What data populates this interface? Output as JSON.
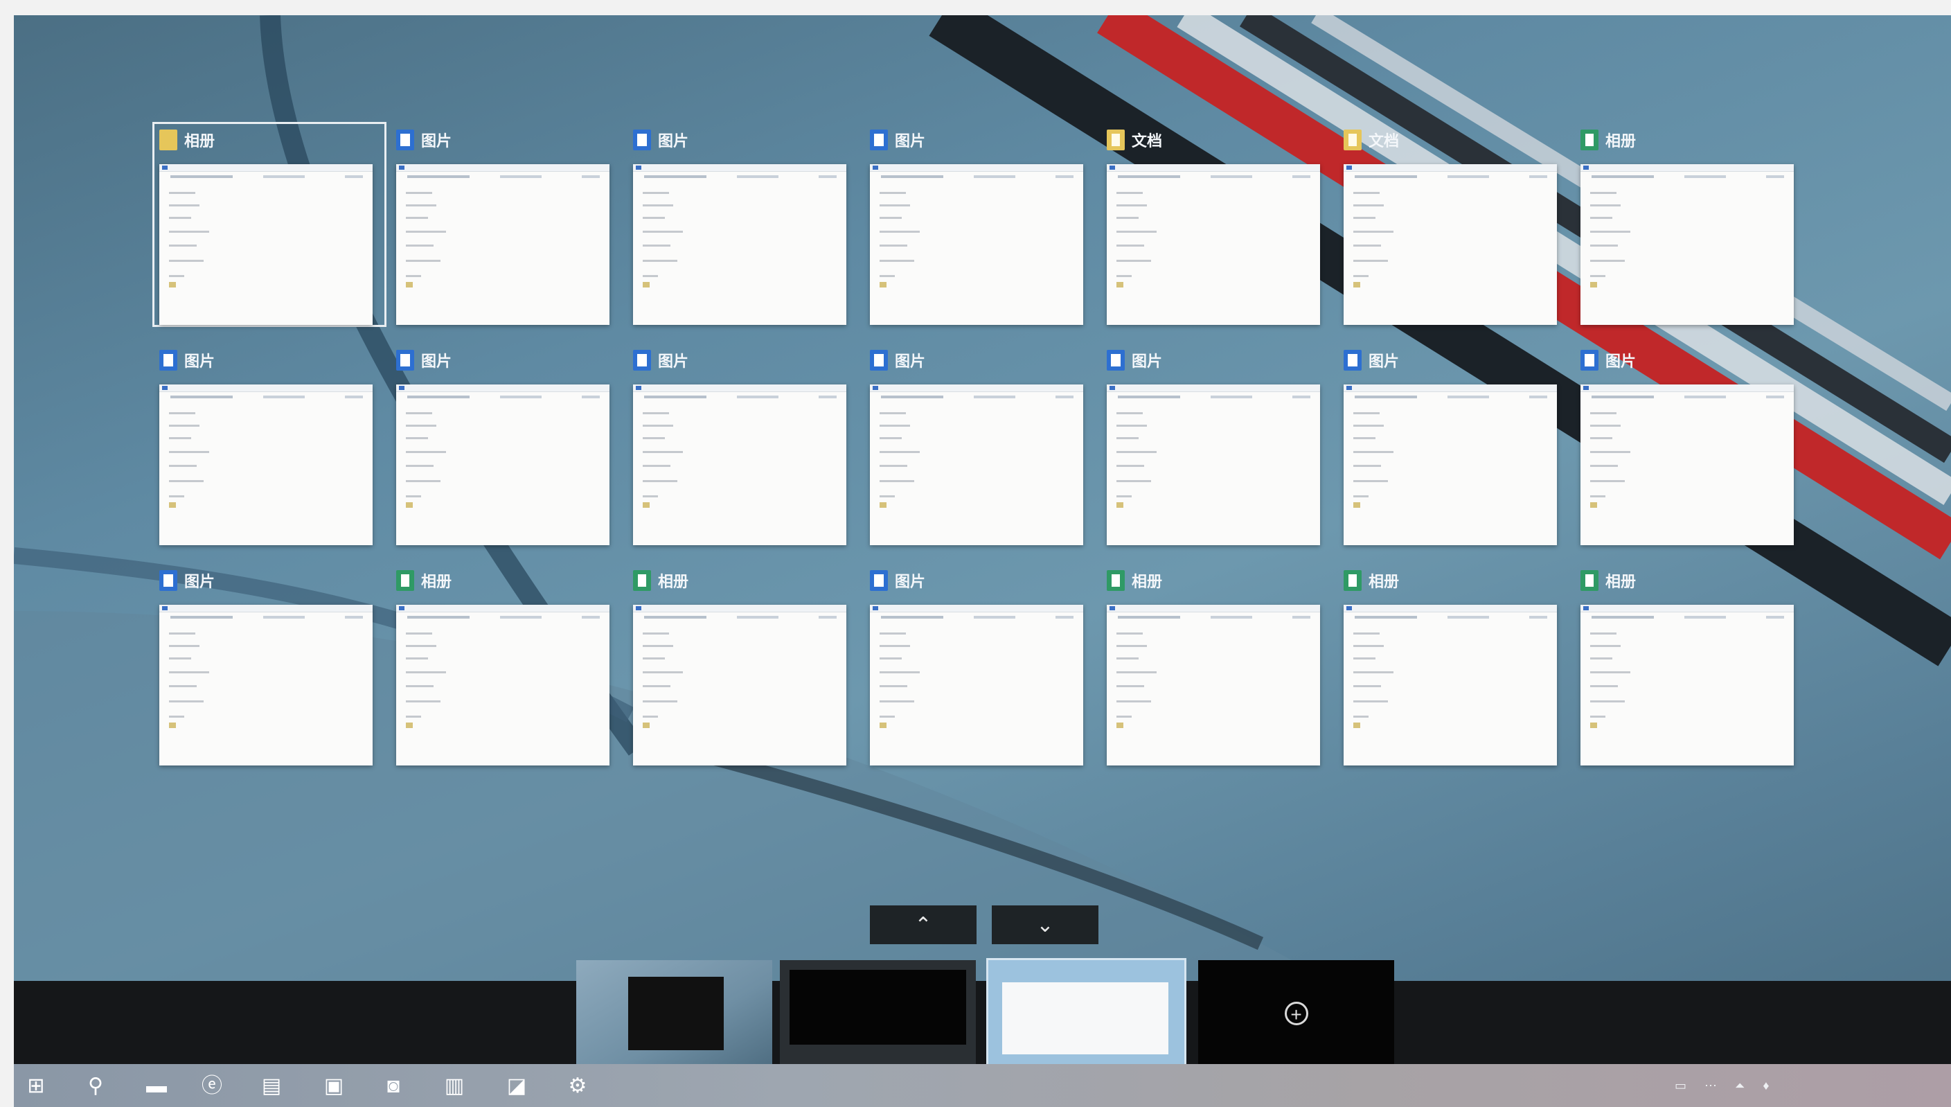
{
  "wallpaper": {
    "base_color": "#5f8aa3",
    "stripe_red": "#c0282a",
    "stripe_dark": "#1b2228"
  },
  "task_view": {
    "windows": [
      {
        "title": "相册",
        "icon": "folder-icon",
        "selected": true
      },
      {
        "title": "图片",
        "icon": "blue-doc-icon"
      },
      {
        "title": "图片",
        "icon": "blue-doc-icon"
      },
      {
        "title": "图片",
        "icon": "blue-doc-icon"
      },
      {
        "title": "文档",
        "icon": "folder-doc-icon"
      },
      {
        "title": "文档",
        "icon": "folder-doc-icon"
      },
      {
        "title": "相册",
        "icon": "green-doc-icon"
      },
      {
        "title": "图片",
        "icon": "blue-doc-icon"
      },
      {
        "title": "图片",
        "icon": "blue-doc-icon"
      },
      {
        "title": "图片",
        "icon": "blue-doc-icon"
      },
      {
        "title": "图片",
        "icon": "blue-doc-icon"
      },
      {
        "title": "图片",
        "icon": "blue-doc-icon"
      },
      {
        "title": "图片",
        "icon": "blue-doc-icon"
      },
      {
        "title": "图片",
        "icon": "blue-doc-icon"
      },
      {
        "title": "图片",
        "icon": "blue-doc-icon"
      },
      {
        "title": "相册",
        "icon": "green-doc-icon"
      },
      {
        "title": "相册",
        "icon": "green-doc-icon"
      },
      {
        "title": "图片",
        "icon": "blue-doc-icon"
      },
      {
        "title": "相册",
        "icon": "green-doc-icon"
      },
      {
        "title": "相册",
        "icon": "green-doc-icon"
      },
      {
        "title": "相册",
        "icon": "green-doc-icon"
      }
    ],
    "scroll_up": "⌃",
    "scroll_down": "⌄"
  },
  "virtual_desktops": {
    "items": [
      {
        "name": "desktop-1"
      },
      {
        "name": "desktop-2"
      },
      {
        "name": "desktop-3",
        "active": true
      }
    ],
    "add_symbol": "+"
  },
  "taskbar": {
    "items": [
      {
        "name": "start-button-icon",
        "glyph": "⊞"
      },
      {
        "name": "search-icon",
        "glyph": "⚲"
      },
      {
        "name": "task-view-icon",
        "glyph": "▬"
      },
      {
        "name": "browser-icon",
        "glyph": "ⓔ"
      },
      {
        "name": "file-explorer-icon",
        "glyph": "▤"
      },
      {
        "name": "store-icon",
        "glyph": "▣"
      },
      {
        "name": "app-blue-icon",
        "glyph": "◙"
      },
      {
        "name": "spreadsheet-icon",
        "glyph": "▥"
      },
      {
        "name": "photos-icon",
        "glyph": "◪"
      },
      {
        "name": "settings-icon",
        "glyph": "⚙"
      }
    ],
    "tray": [
      "▭",
      "⋯",
      "⏶",
      "♦"
    ]
  }
}
